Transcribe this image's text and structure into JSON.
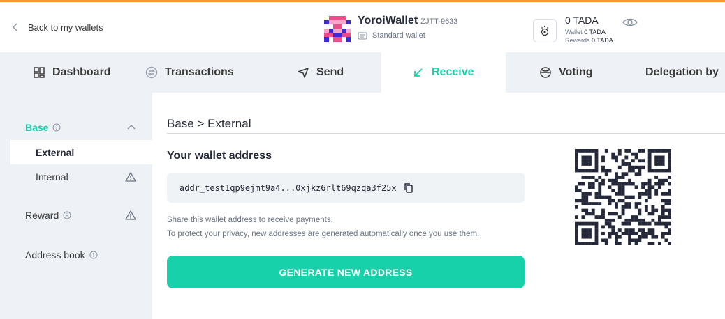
{
  "header": {
    "back_label": "Back to my wallets",
    "wallet_name": "YoroiWallet",
    "wallet_plate": "ZJTT-9633",
    "wallet_type": "Standard wallet",
    "balance_total": "0 TADA",
    "wallet_balance_label": "Wallet",
    "wallet_balance_value": "0 TADA",
    "rewards_label": "Rewards",
    "rewards_value": "0 TADA"
  },
  "tabs": [
    {
      "label": "Dashboard",
      "icon": "dashboard-icon"
    },
    {
      "label": "Transactions",
      "icon": "transactions-icon"
    },
    {
      "label": "Send",
      "icon": "send-icon"
    },
    {
      "label": "Receive",
      "icon": "receive-icon",
      "active": true
    },
    {
      "label": "Voting",
      "icon": "voting-icon"
    },
    {
      "label": "Delegation by",
      "icon": ""
    }
  ],
  "sidebar": {
    "base_label": "Base",
    "external_label": "External",
    "internal_label": "Internal",
    "reward_label": "Reward",
    "address_book_label": "Address book"
  },
  "main": {
    "breadcrumb": "Base > External",
    "address_title": "Your wallet address",
    "address_value": "addr_test1qp9ejmt9a4...0xjkz6rlt69qzqa3f25x",
    "help_line_1": "Share this wallet address to receive payments.",
    "help_line_2": "To protect your privacy, new addresses are generated automatically once you use them.",
    "generate_button": "GENERATE NEW ADDRESS"
  },
  "colors": {
    "accent": "#17d1aa",
    "top_bar": "#f29b3a",
    "background": "#eef1f6"
  }
}
